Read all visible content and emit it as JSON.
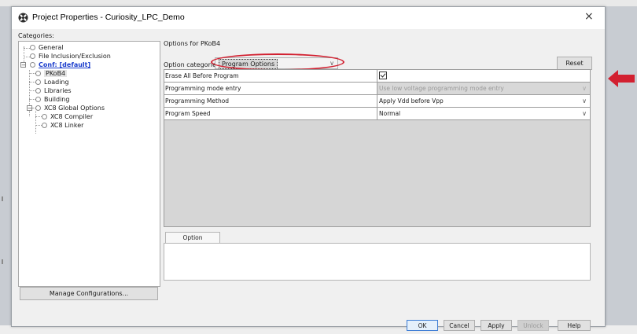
{
  "window": {
    "title": "Project Properties - Curiosity_LPC_Demo",
    "app_icon": "gear-app-icon",
    "close_symbol": "×"
  },
  "categories": {
    "label": "Categories:",
    "items": [
      {
        "label": "General"
      },
      {
        "label": "File Inclusion/Exclusion"
      },
      {
        "label": "Conf: [default]"
      },
      {
        "label": "PKoB4"
      },
      {
        "label": "Loading"
      },
      {
        "label": "Libraries"
      },
      {
        "label": "Building"
      },
      {
        "label": "XC8 Global Options"
      },
      {
        "label": "XC8 Compiler"
      },
      {
        "label": "XC8 Linker"
      }
    ],
    "expander_symbol": "−"
  },
  "manage_button": "Manage Configurations...",
  "options": {
    "header": "Options for PKoB4",
    "category_label": "Option categories:",
    "category_value": "Program Options",
    "category_caret": "∨",
    "reset_label": "Reset"
  },
  "properties": [
    {
      "name": "Erase All Before Program",
      "value": "",
      "type": "checkbox",
      "checked": true
    },
    {
      "name": "Programming mode entry",
      "value": "Use low voltage programming mode entry",
      "type": "select",
      "disabled": true
    },
    {
      "name": "Programming Method",
      "value": "Apply Vdd before Vpp",
      "type": "select",
      "disabled": false
    },
    {
      "name": "Program Speed",
      "value": "Normal",
      "type": "select",
      "disabled": false
    }
  ],
  "dropdown_caret": "∨",
  "description": {
    "tab_label": "Option Description",
    "text": ""
  },
  "buttons": {
    "ok": "OK",
    "cancel": "Cancel",
    "apply": "Apply",
    "unlock": "Unlock",
    "help": "Help"
  },
  "colors": {
    "annotation_red": "#d22030",
    "link_blue": "#1a3ccc"
  }
}
